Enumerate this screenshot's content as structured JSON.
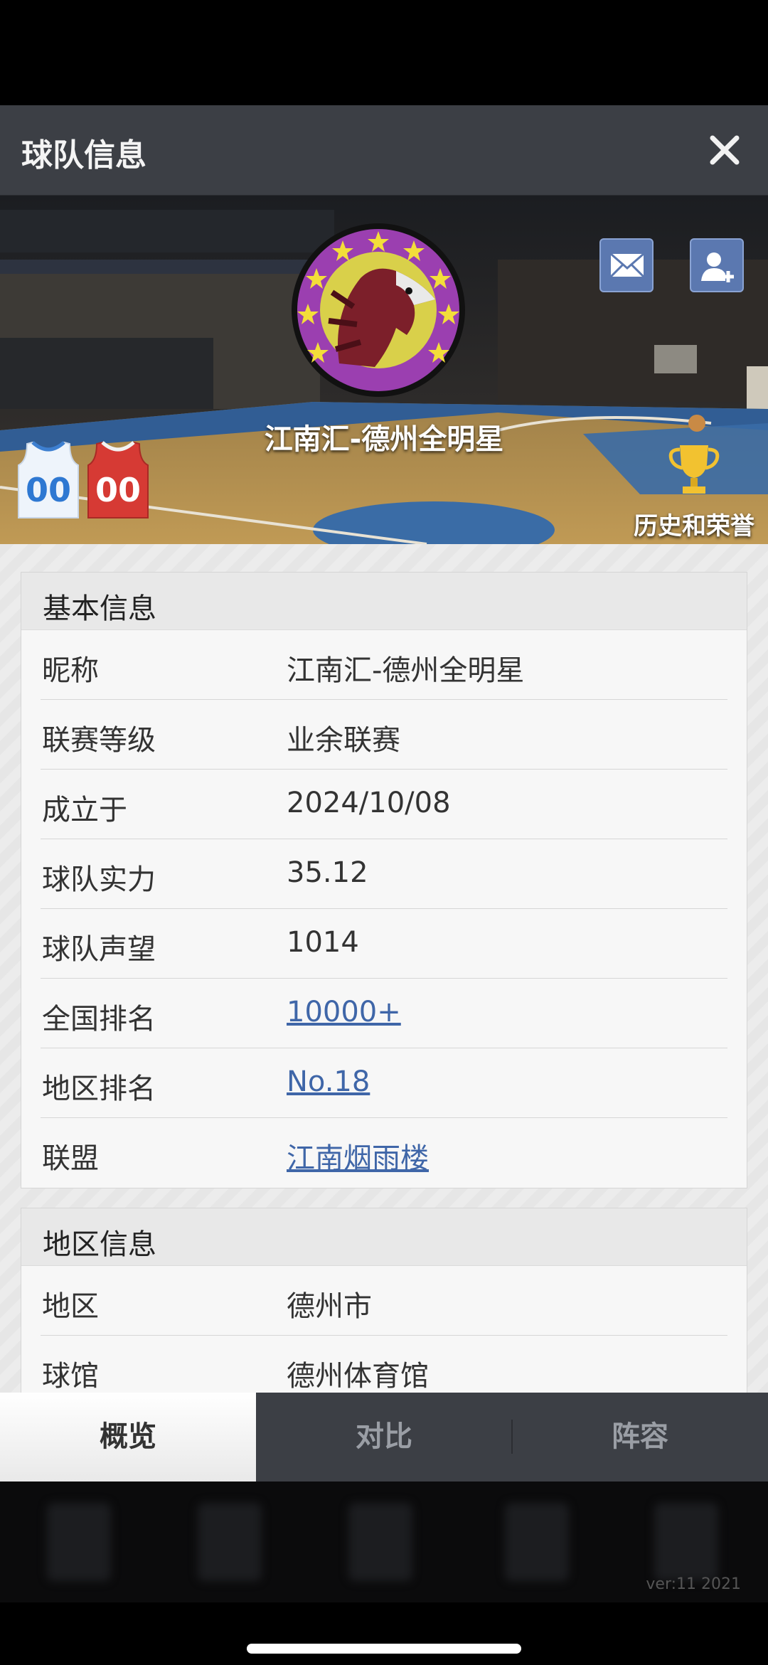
{
  "header": {
    "title": "球队信息",
    "close_icon": "close-icon"
  },
  "banner": {
    "team_name": "江南汇-德州全明星",
    "icons": {
      "mail": "mail-icon",
      "add_user": "add-user-icon",
      "trophy": "trophy-icon",
      "logo": "team-logo-eagle"
    },
    "home_jersey_number": "00",
    "away_jersey_number": "00",
    "honor_label": "历史和荣誉"
  },
  "basic_info": {
    "title": "基本信息",
    "rows": [
      {
        "label": "昵称",
        "value": "江南汇-德州全明星"
      },
      {
        "label": "联赛等级",
        "value": "业余联赛"
      },
      {
        "label": "成立于",
        "value": "2024/10/08"
      },
      {
        "label": "球队实力",
        "value": "35.12"
      },
      {
        "label": "球队声望",
        "value": "1014"
      },
      {
        "label": "全国排名",
        "value": "10000+"
      },
      {
        "label": "地区排名",
        "value": "No.18"
      },
      {
        "label": "联盟",
        "value": "江南烟雨楼"
      }
    ]
  },
  "region_info": {
    "title": "地区信息",
    "rows": [
      {
        "label": "地区",
        "value": "德州市"
      },
      {
        "label": "球馆",
        "value": "德州体育馆"
      }
    ]
  },
  "tabs": [
    {
      "label": "概览",
      "active": true
    },
    {
      "label": "对比",
      "active": false
    },
    {
      "label": "阵容",
      "active": false
    }
  ],
  "footer": {
    "version": "ver:11  2021"
  },
  "colors": {
    "header": "#3c3f45",
    "link": "#3f66a8",
    "logo_ring": "#9b3fb0",
    "button": "#5b78b0"
  }
}
